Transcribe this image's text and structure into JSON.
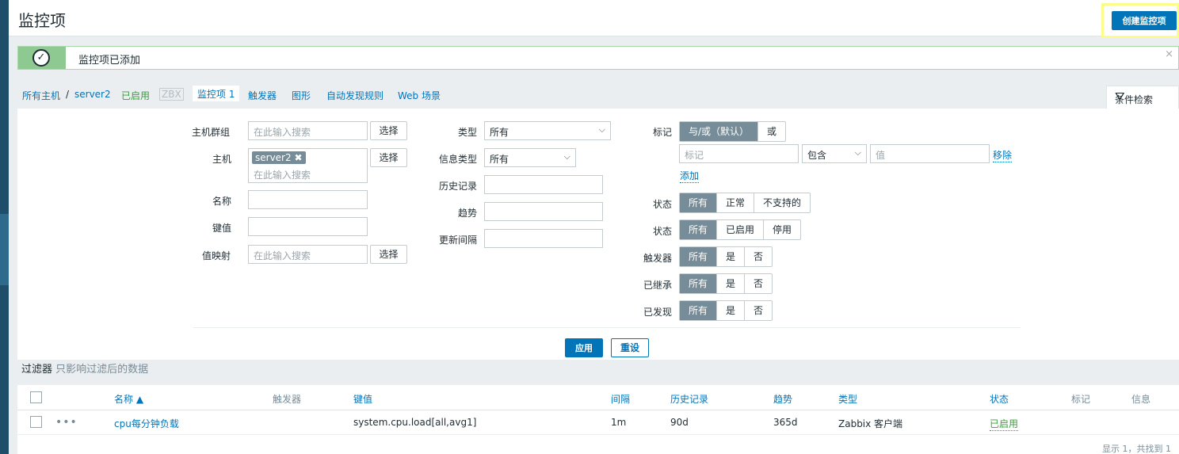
{
  "header": {
    "title": "监控项",
    "create_button": "创建监控项"
  },
  "message": {
    "text": "监控项已添加",
    "check_symbol": "✓",
    "close_symbol": "×"
  },
  "nav": {
    "all_hosts": "所有主机",
    "separator": "/",
    "host": "server2",
    "enabled": "已启用",
    "zbx": "ZBX",
    "items_tab": "监控项 1",
    "triggers": "触发器",
    "graphs": "图形",
    "discovery": "自动发现规则",
    "web": "Web 场景",
    "filter_tab": "条件检索",
    "funnel_symbol": "⛛"
  },
  "filter": {
    "host_group_label": "主机群组",
    "host_group_placeholder": "在此输入搜索",
    "host_label": "主机",
    "host_chip": "server2",
    "host_chip_remove": "✖",
    "host_placeholder": "在此输入搜索",
    "select_btn": "选择",
    "name_label": "名称",
    "key_label": "键值",
    "valuemap_label": "值映射",
    "valuemap_placeholder": "在此输入搜索",
    "type_label": "类型",
    "type_value": "所有",
    "info_type_label": "信息类型",
    "info_type_value": "所有",
    "history_label": "历史记录",
    "trends_label": "趋势",
    "interval_label": "更新间隔",
    "tags_label": "标记",
    "tags_mode": [
      "与/或（默认）",
      "或"
    ],
    "tag_placeholder": "标记",
    "tag_op": "包含",
    "tag_value_placeholder": "值",
    "remove_link": "移除",
    "add_link": "添加",
    "state_label": "状态",
    "state_options": [
      "所有",
      "正常",
      "不支持的"
    ],
    "status_label": "状态",
    "status_options": [
      "所有",
      "已启用",
      "停用"
    ],
    "triggers_label": "触发器",
    "triggers_options": [
      "所有",
      "是",
      "否"
    ],
    "inherited_label": "已继承",
    "inherited_options": [
      "所有",
      "是",
      "否"
    ],
    "discovered_label": "已发现",
    "discovered_options": [
      "所有",
      "是",
      "否"
    ],
    "apply": "应用",
    "reset": "重设",
    "chevron": "⌵"
  },
  "filter_note": {
    "main": "过滤器",
    "sub": "只影响过滤后的数据"
  },
  "table": {
    "headers": [
      "名称 ▲",
      "触发器",
      "键值",
      "间隔",
      "历史记录",
      "趋势",
      "类型",
      "状态",
      "标记",
      "信息"
    ],
    "rows": [
      {
        "dots": "•••",
        "name": "cpu每分钟负载",
        "triggers": "",
        "key": "system.cpu.load[all,avg1]",
        "interval": "1m",
        "history": "90d",
        "trends": "365d",
        "type": "Zabbix 客户端",
        "status": "已启用"
      }
    ],
    "footer": "显示 1，共找到 1"
  }
}
